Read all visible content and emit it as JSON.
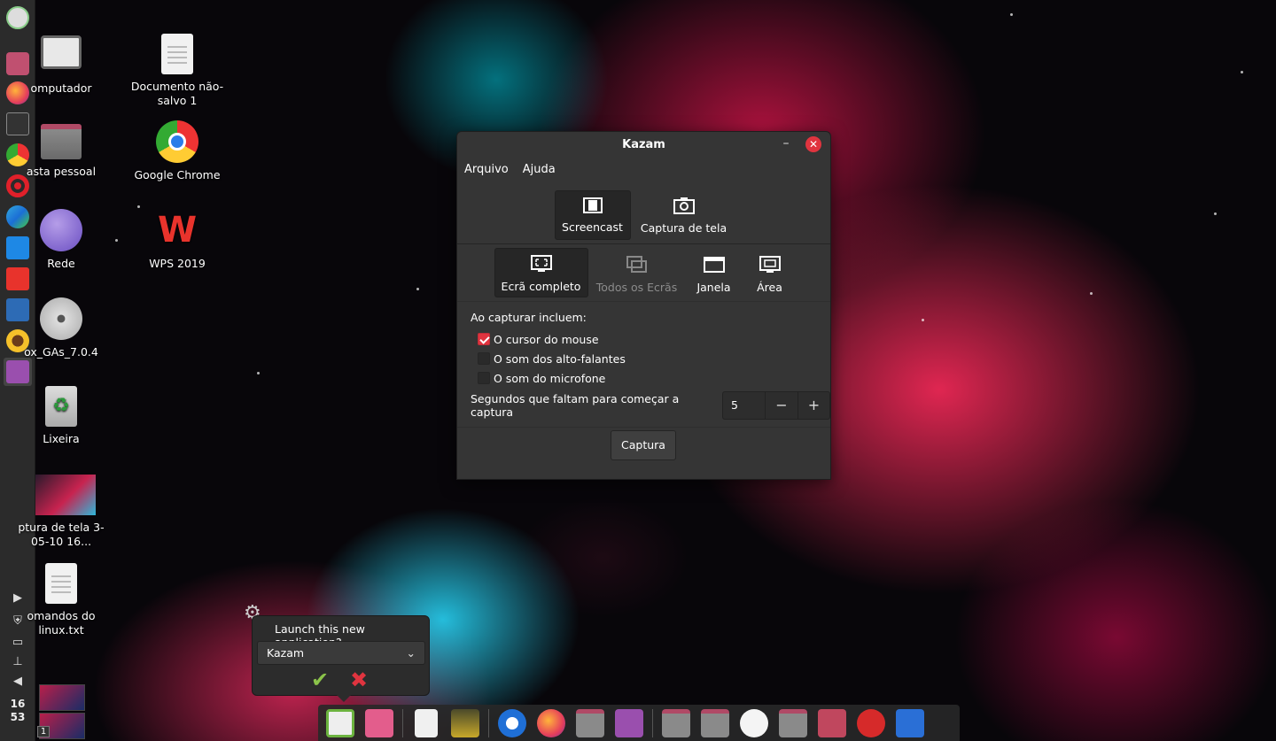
{
  "desktop": {
    "icons": [
      {
        "name": "computer",
        "label": "omputador"
      },
      {
        "name": "document",
        "label": "Documento não-salvo 1"
      },
      {
        "name": "home-folder",
        "label": "asta pessoal"
      },
      {
        "name": "google-chrome",
        "label": "Google Chrome"
      },
      {
        "name": "network",
        "label": "Rede"
      },
      {
        "name": "wps",
        "label": "WPS 2019"
      },
      {
        "name": "vbox-cd",
        "label": "ox_GAs_7.0.4"
      },
      {
        "name": "trash",
        "label": "Lixeira"
      },
      {
        "name": "screenshot-file",
        "label": "ptura de tela 3-05-10 16..."
      },
      {
        "name": "text-file",
        "label": "omandos do linux.txt"
      }
    ]
  },
  "clock": {
    "hour": "16",
    "minute": "53"
  },
  "workspace_badge": "1",
  "window": {
    "title": "Kazam",
    "menu": [
      "Arquivo",
      "Ajuda"
    ],
    "modes": [
      "Screencast",
      "Captura de tela"
    ],
    "targets": [
      "Ecrã completo",
      "Todos os Ecrãs",
      "Janela",
      "Área"
    ],
    "include_label": "Ao capturar incluem:",
    "options": [
      {
        "label": "O cursor do mouse",
        "checked": true
      },
      {
        "label": "O som dos alto-falantes",
        "checked": false
      },
      {
        "label": "O som do microfone",
        "checked": false
      }
    ],
    "countdown_label": "Segundos que faltam para começar a captura",
    "countdown_value": "5",
    "minus": "−",
    "plus": "+",
    "capture_button": "Captura"
  },
  "popup": {
    "question": "Launch this new application?",
    "selected": "Kazam",
    "confirm": "✔",
    "cancel": "✖"
  },
  "colors": {
    "accent": "#e0343f",
    "window_bg": "#353535",
    "panel_bg": "#2b2b2b"
  }
}
